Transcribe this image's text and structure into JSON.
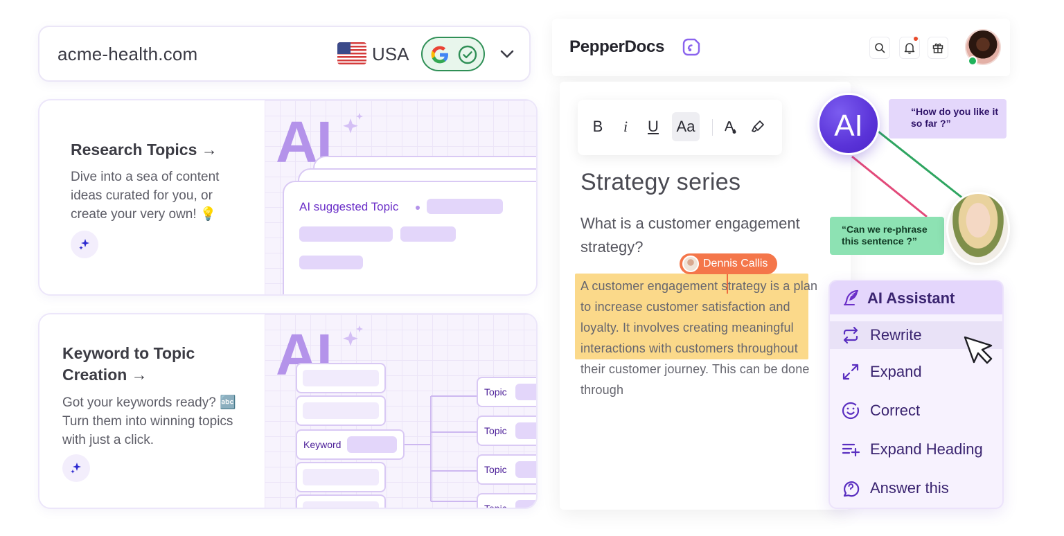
{
  "domain_bar": {
    "domain": "acme-health.com",
    "country": "USA",
    "flag_icon": "us-flag-icon",
    "status_icon": "google-check-icon"
  },
  "cards": [
    {
      "title": "Research Topics →",
      "description": "Dive into a sea of content ideas curated for you, or create your very own! 💡",
      "art_label": "AI",
      "panel_label": "AI suggested Topic"
    },
    {
      "title_line1": "Keyword to Topic",
      "title_line2": "Creation →",
      "description": "Got your keywords ready? 🔤 Turn them into winning topics with just a click.",
      "art_label": "AI",
      "keyword_label": "Keyword",
      "topic_labels": [
        "Topic",
        "Topic",
        "Topic",
        "Topic"
      ]
    }
  ],
  "header": {
    "app_name": "PepperDocs"
  },
  "toolbar": {
    "bold": "B",
    "italic": "i",
    "underline": "U",
    "font_size": "Aa"
  },
  "document": {
    "title": "Strategy series",
    "question": "What is a customer engagement strategy?",
    "body": "A customer engagement strategy is a plan to increase customer satisfaction and loyalty. It involves creating meaningful interactions with customers throughout their customer journey. This can be done through",
    "collaborator": "Dennis Callis"
  },
  "collab": {
    "ai_badge": "AI",
    "comment1": "“How do you like it so far ?”",
    "comment2": "“Can we re-phrase this sentence ?”"
  },
  "ai_assistant": {
    "title": "AI Assistant",
    "items": [
      {
        "label": "Rewrite",
        "icon": "rewrite-icon"
      },
      {
        "label": "Expand",
        "icon": "expand-icon"
      },
      {
        "label": "Correct",
        "icon": "correct-icon"
      },
      {
        "label": "Expand Heading",
        "icon": "expand-heading-icon"
      },
      {
        "label": "Answer this",
        "icon": "answer-icon"
      }
    ]
  },
  "colors": {
    "accent_purple": "#6b2fc8",
    "highlight_yellow": "#fbd98a",
    "collaborator_orange": "#f4764a",
    "google_green": "#2f8f56"
  }
}
